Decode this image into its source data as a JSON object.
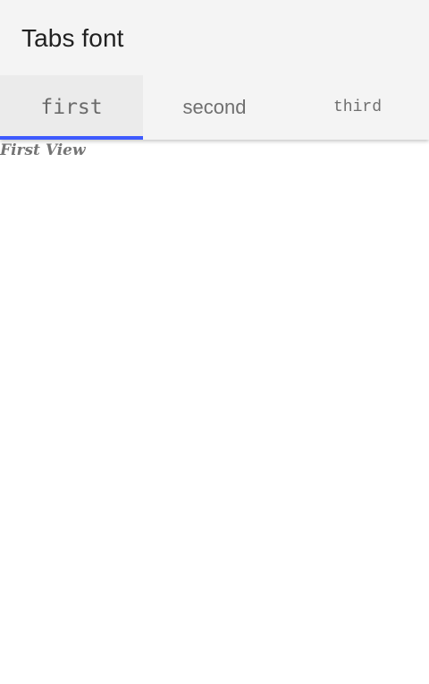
{
  "app": {
    "title": "Tabs font"
  },
  "tabs": [
    {
      "label": "first",
      "selected": true
    },
    {
      "label": "second",
      "selected": false
    },
    {
      "label": "third",
      "selected": false
    }
  ],
  "content": {
    "view_text": "First View"
  },
  "colors": {
    "indicator": "#3d5afe",
    "header_background": "#f4f4f4",
    "selected_tab_background": "#ebebeb"
  }
}
